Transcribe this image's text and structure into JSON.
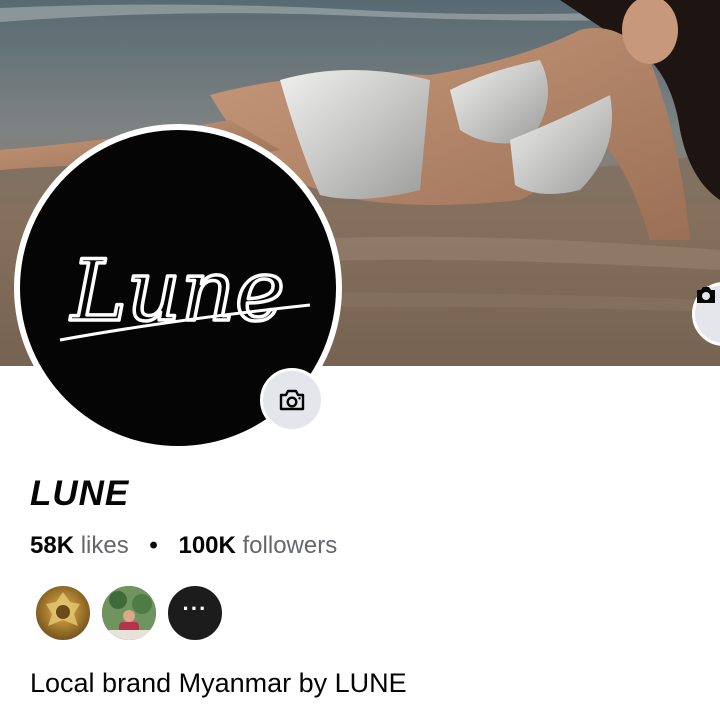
{
  "page": {
    "name": "LUNE",
    "logo_text": "Lune",
    "likes_count": "58K",
    "likes_label": "likes",
    "separator": "•",
    "followers_count": "100K",
    "followers_label": "followers",
    "bio": "Local brand Myanmar by LUNE"
  },
  "mutual_friends": {
    "more_label": "···"
  },
  "icons": {
    "cover_edit": "camera-icon",
    "avatar_edit": "camera-icon",
    "more": "more-dots-icon"
  },
  "colors": {
    "primary_text": "#050505",
    "secondary_text": "#65676b",
    "button_bg": "#e4e6eb",
    "avatar_bg": "#050505"
  }
}
